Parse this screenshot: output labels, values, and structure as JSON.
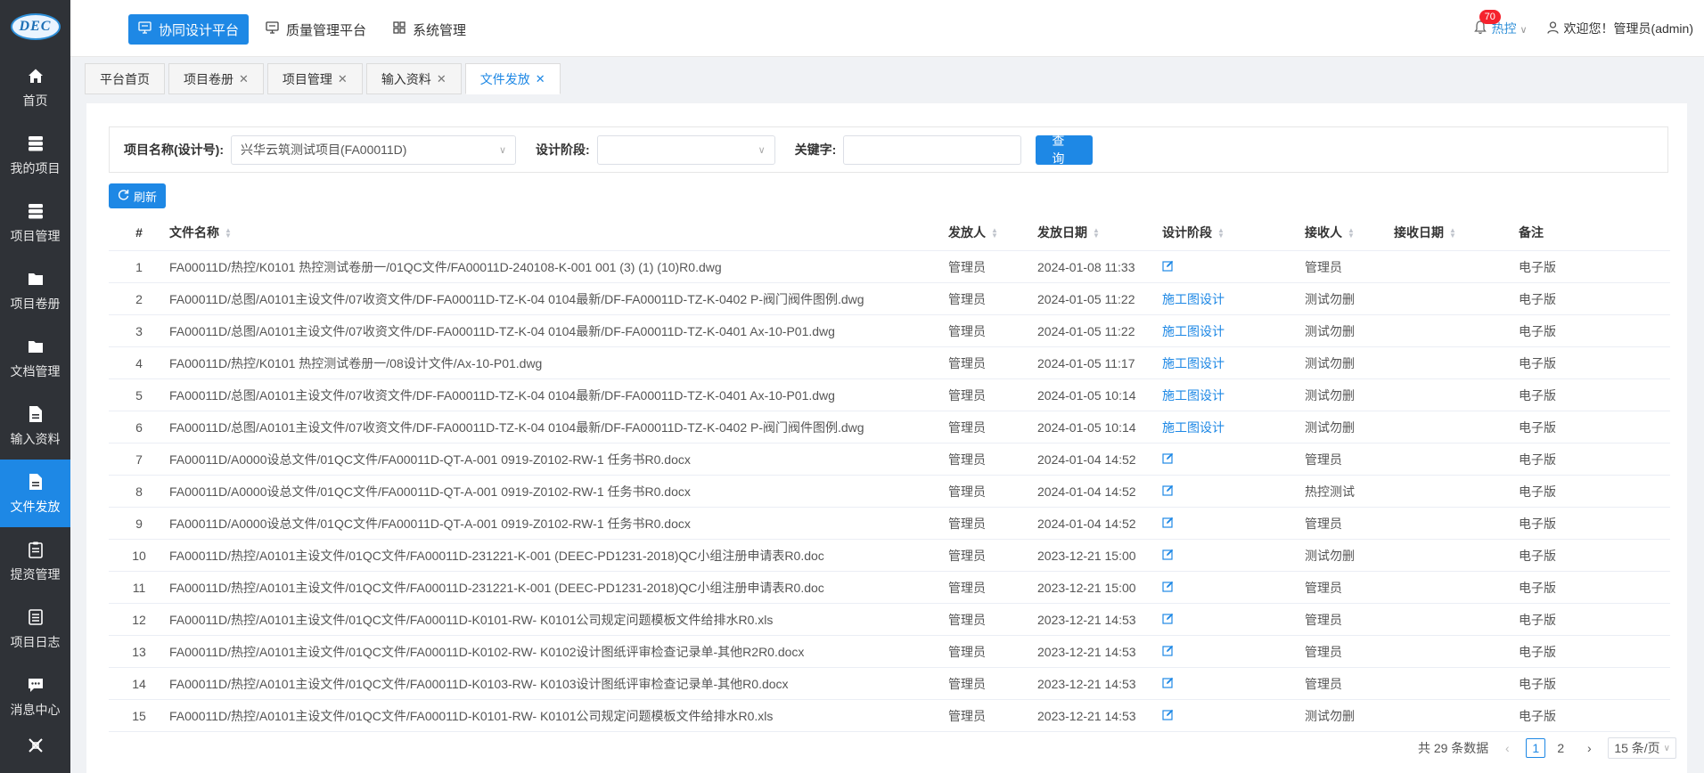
{
  "logo": {
    "text": "DEC"
  },
  "sidebar": {
    "items": [
      {
        "label": "首页",
        "icon": "home-icon",
        "active": false
      },
      {
        "label": "我的项目",
        "icon": "database-icon",
        "active": false
      },
      {
        "label": "项目管理",
        "icon": "database-icon",
        "active": false
      },
      {
        "label": "项目卷册",
        "icon": "folder-icon",
        "active": false
      },
      {
        "label": "文档管理",
        "icon": "folder-icon",
        "active": false
      },
      {
        "label": "输入资料",
        "icon": "document-icon",
        "active": false
      },
      {
        "label": "文件发放",
        "icon": "document-icon",
        "active": true
      },
      {
        "label": "提资管理",
        "icon": "clipboard-icon",
        "active": false
      },
      {
        "label": "项目日志",
        "icon": "list-icon",
        "active": false
      },
      {
        "label": "消息中心",
        "icon": "chat-icon",
        "active": false
      }
    ]
  },
  "topnav": {
    "items": [
      {
        "label": "协同设计平台",
        "active": true
      },
      {
        "label": "质量管理平台",
        "active": false
      },
      {
        "label": "系统管理",
        "active": false
      }
    ]
  },
  "header": {
    "notify_count": "70",
    "dept": "热控",
    "greeting": "欢迎您！管理员(admin)"
  },
  "tabs": [
    {
      "label": "平台首页",
      "closable": false,
      "active": false
    },
    {
      "label": "项目卷册",
      "closable": true,
      "active": false
    },
    {
      "label": "项目管理",
      "closable": true,
      "active": false
    },
    {
      "label": "输入资料",
      "closable": true,
      "active": false
    },
    {
      "label": "文件发放",
      "closable": true,
      "active": true
    }
  ],
  "filter": {
    "project_label": "项目名称(设计号):",
    "project_value": "兴华云筑测试项目(FA00011D)",
    "stage_label": "设计阶段:",
    "stage_value": "",
    "keyword_label": "关键字:",
    "keyword_value": "",
    "query_label": "查询"
  },
  "refresh_label": "刷新",
  "table": {
    "columns": [
      "#",
      "文件名称",
      "发放人",
      "发放日期",
      "设计阶段",
      "接收人",
      "接收日期",
      "备注"
    ],
    "rows": [
      {
        "no": "1",
        "name": "FA00011D/热控/K0101 热控测试卷册一/01QC文件/FA00011D-240108-K-001 001 (3) (1) (10)R0.dwg",
        "sender": "管理员",
        "date": "2024-01-08 11:33",
        "stage": "",
        "receiver": "管理员",
        "recv_date": "",
        "note": "电子版"
      },
      {
        "no": "2",
        "name": "FA00011D/总图/A0101主设文件/07收资文件/DF-FA00011D-TZ-K-04 0104最新/DF-FA00011D-TZ-K-0402 P-阀门阀件图例.dwg",
        "sender": "管理员",
        "date": "2024-01-05 11:22",
        "stage": "施工图设计",
        "receiver": "测试勿删",
        "recv_date": "",
        "note": "电子版"
      },
      {
        "no": "3",
        "name": "FA00011D/总图/A0101主设文件/07收资文件/DF-FA00011D-TZ-K-04 0104最新/DF-FA00011D-TZ-K-0401 Ax-10-P01.dwg",
        "sender": "管理员",
        "date": "2024-01-05 11:22",
        "stage": "施工图设计",
        "receiver": "测试勿删",
        "recv_date": "",
        "note": "电子版"
      },
      {
        "no": "4",
        "name": "FA00011D/热控/K0101 热控测试卷册一/08设计文件/Ax-10-P01.dwg",
        "sender": "管理员",
        "date": "2024-01-05 11:17",
        "stage": "施工图设计",
        "receiver": "测试勿删",
        "recv_date": "",
        "note": "电子版"
      },
      {
        "no": "5",
        "name": "FA00011D/总图/A0101主设文件/07收资文件/DF-FA00011D-TZ-K-04 0104最新/DF-FA00011D-TZ-K-0401 Ax-10-P01.dwg",
        "sender": "管理员",
        "date": "2024-01-05 10:14",
        "stage": "施工图设计",
        "receiver": "测试勿删",
        "recv_date": "",
        "note": "电子版"
      },
      {
        "no": "6",
        "name": "FA00011D/总图/A0101主设文件/07收资文件/DF-FA00011D-TZ-K-04 0104最新/DF-FA00011D-TZ-K-0402 P-阀门阀件图例.dwg",
        "sender": "管理员",
        "date": "2024-01-05 10:14",
        "stage": "施工图设计",
        "receiver": "测试勿删",
        "recv_date": "",
        "note": "电子版"
      },
      {
        "no": "7",
        "name": "FA00011D/A0000设总文件/01QC文件/FA00011D-QT-A-001 0919-Z0102-RW-1 任务书R0.docx",
        "sender": "管理员",
        "date": "2024-01-04 14:52",
        "stage": "",
        "receiver": "管理员",
        "recv_date": "",
        "note": "电子版"
      },
      {
        "no": "8",
        "name": "FA00011D/A0000设总文件/01QC文件/FA00011D-QT-A-001 0919-Z0102-RW-1 任务书R0.docx",
        "sender": "管理员",
        "date": "2024-01-04 14:52",
        "stage": "",
        "receiver": "热控测试",
        "recv_date": "",
        "note": "电子版"
      },
      {
        "no": "9",
        "name": "FA00011D/A0000设总文件/01QC文件/FA00011D-QT-A-001 0919-Z0102-RW-1 任务书R0.docx",
        "sender": "管理员",
        "date": "2024-01-04 14:52",
        "stage": "",
        "receiver": "管理员",
        "recv_date": "",
        "note": "电子版"
      },
      {
        "no": "10",
        "name": "FA00011D/热控/A0101主设文件/01QC文件/FA00011D-231221-K-001 (DEEC-PD1231-2018)QC小组注册申请表R0.doc",
        "sender": "管理员",
        "date": "2023-12-21 15:00",
        "stage": "",
        "receiver": "测试勿删",
        "recv_date": "",
        "note": "电子版"
      },
      {
        "no": "11",
        "name": "FA00011D/热控/A0101主设文件/01QC文件/FA00011D-231221-K-001 (DEEC-PD1231-2018)QC小组注册申请表R0.doc",
        "sender": "管理员",
        "date": "2023-12-21 15:00",
        "stage": "",
        "receiver": "管理员",
        "recv_date": "",
        "note": "电子版"
      },
      {
        "no": "12",
        "name": "FA00011D/热控/A0101主设文件/01QC文件/FA00011D-K0101-RW- K0101公司规定问题模板文件给排水R0.xls",
        "sender": "管理员",
        "date": "2023-12-21 14:53",
        "stage": "",
        "receiver": "管理员",
        "recv_date": "",
        "note": "电子版"
      },
      {
        "no": "13",
        "name": "FA00011D/热控/A0101主设文件/01QC文件/FA00011D-K0102-RW- K0102设计图纸评审检查记录单-其他R2R0.docx",
        "sender": "管理员",
        "date": "2023-12-21 14:53",
        "stage": "",
        "receiver": "管理员",
        "recv_date": "",
        "note": "电子版"
      },
      {
        "no": "14",
        "name": "FA00011D/热控/A0101主设文件/01QC文件/FA00011D-K0103-RW- K0103设计图纸评审检查记录单-其他R0.docx",
        "sender": "管理员",
        "date": "2023-12-21 14:53",
        "stage": "",
        "receiver": "管理员",
        "recv_date": "",
        "note": "电子版"
      },
      {
        "no": "15",
        "name": "FA00011D/热控/A0101主设文件/01QC文件/FA00011D-K0101-RW- K0101公司规定问题模板文件给排水R0.xls",
        "sender": "管理员",
        "date": "2023-12-21 14:53",
        "stage": "",
        "receiver": "测试勿删",
        "recv_date": "",
        "note": "电子版"
      }
    ]
  },
  "pagination": {
    "total_text": "共 29 条数据",
    "pages": [
      "1",
      "2"
    ],
    "current": "1",
    "size_text": "15 条/页"
  },
  "colors": {
    "primary": "#1e88e5",
    "sidebar_bg": "#2f3237",
    "badge": "#f5222d"
  }
}
